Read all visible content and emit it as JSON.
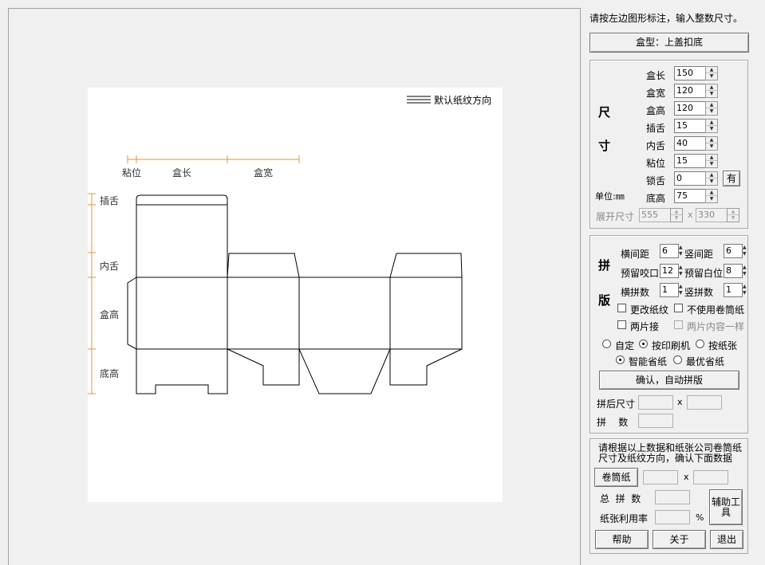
{
  "drawing": {
    "grain_direction_label": "默认纸纹方向",
    "labels": {
      "paste": "粘位",
      "length": "盒长",
      "width": "盒宽",
      "tuck": "插舌",
      "inner_tongue": "内舌",
      "height": "盒高",
      "bottom_height": "底高"
    },
    "colors": {
      "dimension": "#e8962e",
      "outline": "#000000"
    }
  },
  "panel": {
    "instruction": "请按左边图形标注，输入整数尺寸。",
    "box_type_button": "盒型：上盖扣底",
    "size_section": {
      "title_chars": [
        "尺",
        "寸"
      ],
      "fields": [
        {
          "label": "盒长",
          "value": "150"
        },
        {
          "label": "盒宽",
          "value": "120"
        },
        {
          "label": "盒高",
          "value": "120"
        },
        {
          "label": "插舌",
          "value": "15"
        },
        {
          "label": "内舌",
          "value": "40"
        },
        {
          "label": "粘位",
          "value": "15"
        },
        {
          "label": "锁舌",
          "value": "0"
        },
        {
          "label": "底高",
          "value": "75"
        }
      ],
      "lock_button": "有",
      "unit_label": "单位:㎜",
      "unfold_label": "展开尺寸",
      "unfold_w": "555",
      "unfold_x": "x",
      "unfold_h": "330"
    },
    "layout_section": {
      "title_chars": [
        "拼",
        "版"
      ],
      "h_gap_label": "横间距",
      "h_gap": "6",
      "v_gap_label": "竖间距",
      "v_gap": "6",
      "bite_label": "预留咬口",
      "bite": "12",
      "margin_label": "预留白位",
      "margin": "8",
      "h_count_label": "横拼数",
      "h_count": "1",
      "v_count_label": "竖拼数",
      "v_count": "1",
      "change_grain": "更改纸纹",
      "no_roll": "不使用卷筒纸",
      "two_piece": "两片接",
      "two_piece_same": "两片内容一样",
      "radio_custom": "自定",
      "radio_printer": "按印刷机",
      "radio_paper": "按纸张",
      "radio_smart": "智能省纸",
      "radio_best": "最优省纸",
      "confirm_button": "确认，自动拼版",
      "after_size_label": "拼后尺寸",
      "after_x": "x",
      "count_label": "拼    数"
    },
    "roll_section": {
      "hint": "请根据以上数据和纸张公司卷筒纸尺寸及纸纹方向，确认下面数据",
      "roll_button": "卷筒纸",
      "roll_x": "x",
      "total_label": "总  拼  数",
      "utilization_label": "纸张利用率",
      "percent": "%",
      "tool_button": "辅助工具",
      "help_button": "帮助",
      "about_button": "关于",
      "exit_button": "退出"
    }
  }
}
